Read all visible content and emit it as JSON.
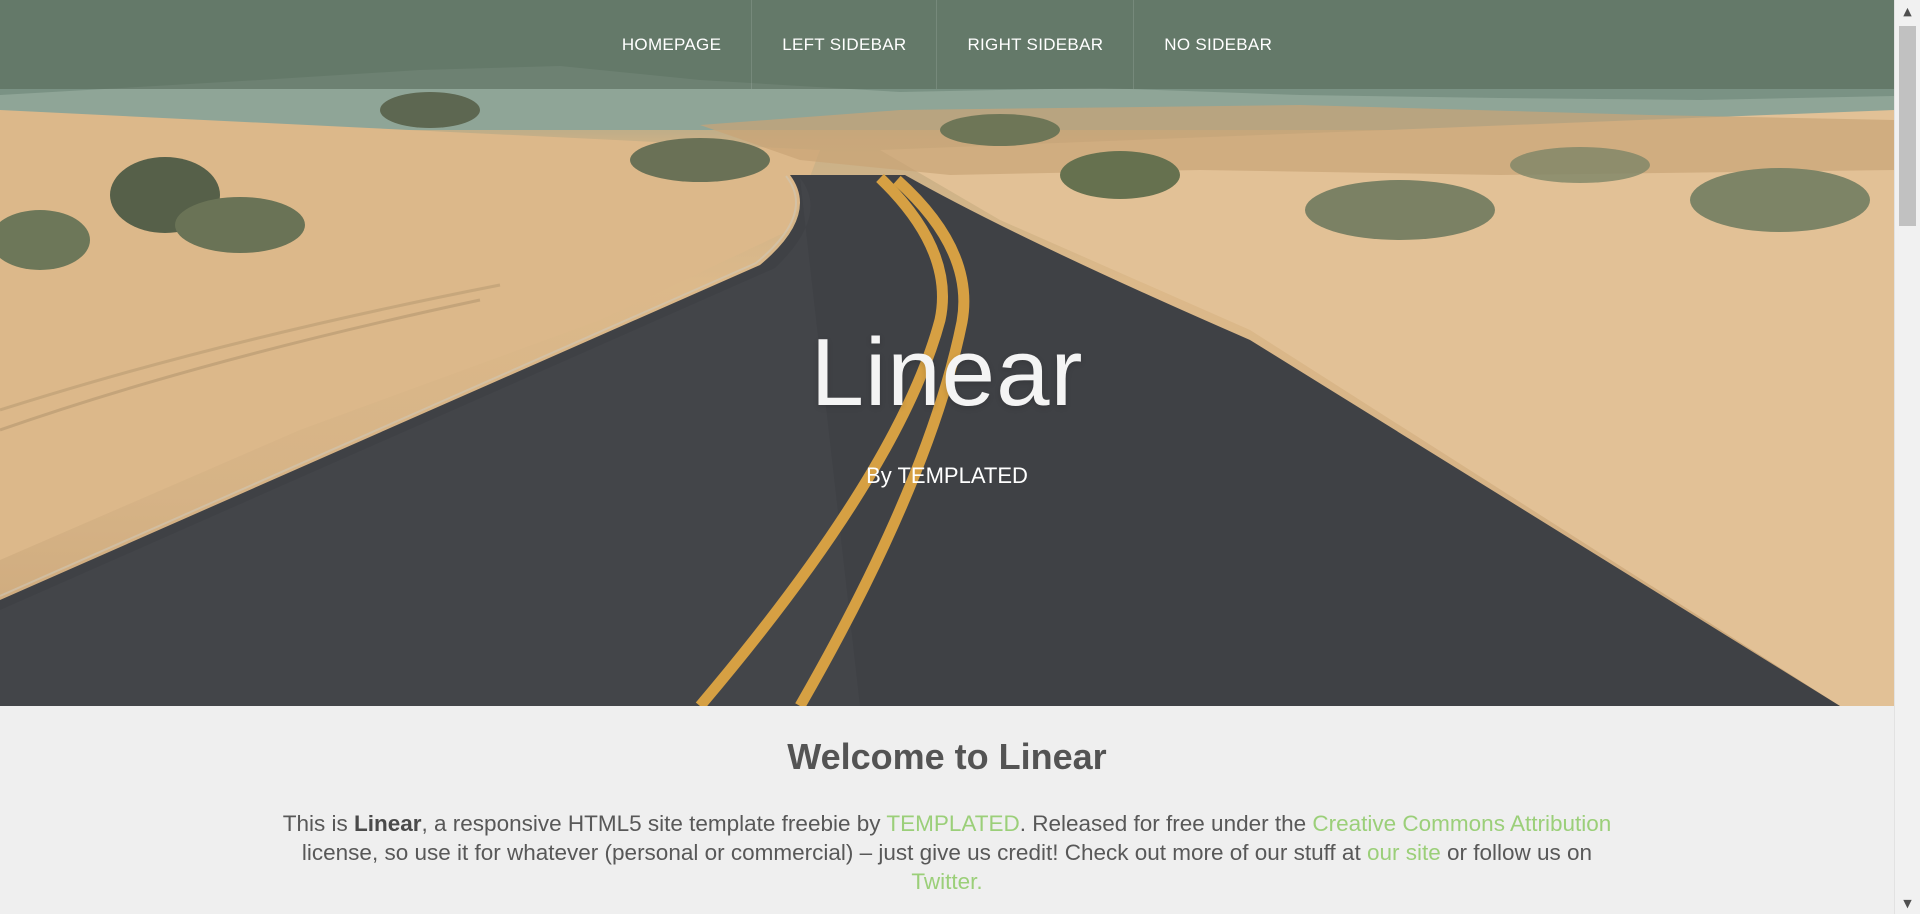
{
  "nav": {
    "items": [
      {
        "label": "HOMEPAGE"
      },
      {
        "label": "LEFT SIDEBAR"
      },
      {
        "label": "RIGHT SIDEBAR"
      },
      {
        "label": "NO SIDEBAR"
      }
    ]
  },
  "hero": {
    "title": "Linear",
    "subtitle": "By TEMPLATED"
  },
  "welcome": {
    "title": "Welcome to Linear",
    "p1": "This is ",
    "brand": "Linear",
    "p2": ", a responsive HTML5 site template freebie by ",
    "link_templated": "TEMPLATED",
    "p3": ". Released for free under the ",
    "link_license": "Creative Commons Attribution",
    "p4": " license, so use it for whatever (personal or commercial) – just give us credit! Check out more of our stuff at ",
    "link_site": "our site",
    "p5": " or follow us on ",
    "link_twitter": "Twitter."
  },
  "colors": {
    "link": "#9bcf79",
    "content_bg": "#efefef",
    "nav_overlay": "rgba(82,100,84,0.55)"
  }
}
